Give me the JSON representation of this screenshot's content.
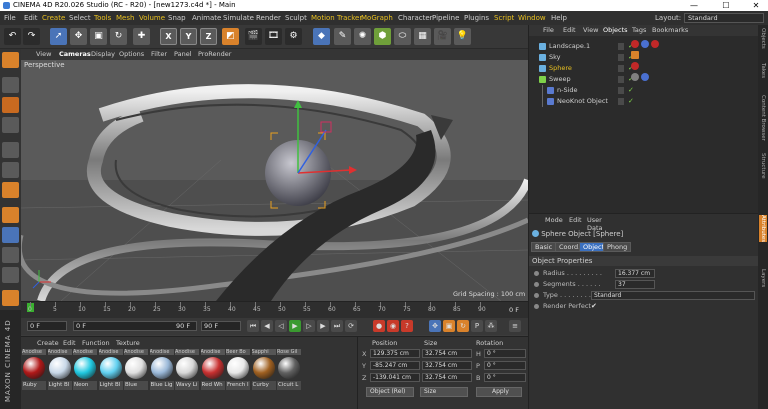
{
  "titlebar": {
    "title": "CINEMA 4D R20.026 Studio (RC - R20) - [new1273.c4d *] - Main",
    "minimize": "—",
    "maximize": "☐",
    "close": "✕"
  },
  "menubar": {
    "items": [
      "File",
      "Edit",
      "Create",
      "Select",
      "Tools",
      "Mesh",
      "Volume",
      "Snap",
      "Animate",
      "Simulate",
      "Render",
      "Sculpt",
      "Motion Tracker",
      "MoGraph",
      "Character",
      "Pipeline",
      "Plugins",
      "Script",
      "Window",
      "Help"
    ],
    "highlighted": [
      "Create",
      "Tools",
      "Mesh",
      "Volume",
      "Motion Tracker",
      "MoGraph",
      "Script",
      "Window"
    ],
    "layout_label": "Layout:",
    "layout_value": "Standard"
  },
  "toolbar": {
    "x": "X",
    "y": "Y",
    "z": "Z"
  },
  "viewport": {
    "menu": [
      "View",
      "Cameras",
      "Display",
      "Options",
      "Filter",
      "Panel",
      "ProRender"
    ],
    "active_menu": "Cameras",
    "camera_label": "Perspective",
    "grid_spacing": "Grid Spacing : 100 cm"
  },
  "timeline": {
    "ticks": [
      "0",
      "5",
      "10",
      "15",
      "20",
      "25",
      "30",
      "35",
      "40",
      "45",
      "50",
      "55",
      "60",
      "65",
      "70",
      "75",
      "80",
      "85",
      "90"
    ],
    "end_label": "0 F"
  },
  "transport": {
    "current": "0 F",
    "start": "0 F",
    "end_field": "90 F",
    "end": "90 F"
  },
  "materials": {
    "menu": [
      "Create",
      "Edit",
      "Function",
      "Texture"
    ],
    "items": [
      {
        "top": "Anodise",
        "label": "Ruby",
        "color": "#b01818"
      },
      {
        "top": "Anodise",
        "label": "Light Bl",
        "color": "#c8d8e8"
      },
      {
        "top": "Anodise",
        "label": "Neon",
        "color": "#20c8e0"
      },
      {
        "top": "Anodise",
        "label": "Light Bl",
        "color": "#60d0f0"
      },
      {
        "top": "Anodise",
        "label": "Blue",
        "color": "#e0e0e0"
      },
      {
        "top": "Anodise",
        "label": "Blue Lig",
        "color": "#9ab8d8"
      },
      {
        "top": "Anodise",
        "label": "Wavy Li",
        "color": "#d8d8d8"
      },
      {
        "top": "Anodise",
        "label": "Red Wh",
        "color": "#c83030"
      },
      {
        "top": "Beer Bo",
        "label": "French I",
        "color": "#e8e8e8"
      },
      {
        "top": "Sapphi",
        "label": "Curby",
        "color": "#a06020"
      },
      {
        "top": "Rose Gil",
        "label": "Cicuit L",
        "color": "#606060"
      }
    ]
  },
  "coords": {
    "headers": {
      "position": "Position",
      "size": "Size",
      "rotation": "Rotation"
    },
    "rows": [
      {
        "axis": "X",
        "pos": "129.375 cm",
        "size": "32.754 cm",
        "rot_axis": "H",
        "rot": "0 °"
      },
      {
        "axis": "Y",
        "pos": "-85.247 cm",
        "size": "32.754 cm",
        "rot_axis": "P",
        "rot": "0 °"
      },
      {
        "axis": "Z",
        "pos": "-139.041 cm",
        "size": "32.754 cm",
        "rot_axis": "B",
        "rot": "0 °"
      }
    ],
    "mode": "Object (Rel)",
    "size_mode": "Size",
    "apply": "Apply"
  },
  "objects": {
    "menu": [
      "File",
      "Edit",
      "View",
      "Objects",
      "Tags",
      "Bookmarks"
    ],
    "rows": [
      {
        "name": "Landscape.1",
        "indent": 0,
        "color": "#6ab0e0",
        "active": false
      },
      {
        "name": "Sky",
        "indent": 0,
        "color": "#6ab0e0",
        "active": false
      },
      {
        "name": "Sphere",
        "indent": 0,
        "color": "#6ab0e0",
        "active": true
      },
      {
        "name": "Sweep",
        "indent": 0,
        "color": "#7fd14a",
        "active": false
      },
      {
        "name": "n-Side",
        "indent": 1,
        "color": "#5a7ad0",
        "active": false
      },
      {
        "name": "NeoKnot Object",
        "indent": 1,
        "color": "#5a7ad0",
        "active": false
      }
    ]
  },
  "attributes": {
    "menu": [
      "Mode",
      "Edit",
      "User Data"
    ],
    "title": "Sphere Object [Sphere]",
    "tabs": [
      "Basic",
      "Coord.",
      "Object",
      "Phong"
    ],
    "active_tab": "Object",
    "section": "Object Properties",
    "props": [
      {
        "label": "Radius . . . . . . . . .",
        "value": "16.377 cm"
      },
      {
        "label": "Segments . . . . . .",
        "value": "37"
      },
      {
        "label": "Type . . . . . . . . . .",
        "value": "Standard"
      },
      {
        "label": "Render Perfect",
        "value": "✔"
      }
    ]
  },
  "sidetabs": [
    "Objects",
    "Takes",
    "Content Browser",
    "Structure",
    "Attributes",
    "Layers"
  ],
  "brand": "MAXON CINEMA 4D",
  "colors": {
    "accent_blue": "#3a70c0",
    "highlight_yellow": "#e8c020",
    "check_green": "#7fd14a",
    "orange": "#d9822b"
  }
}
